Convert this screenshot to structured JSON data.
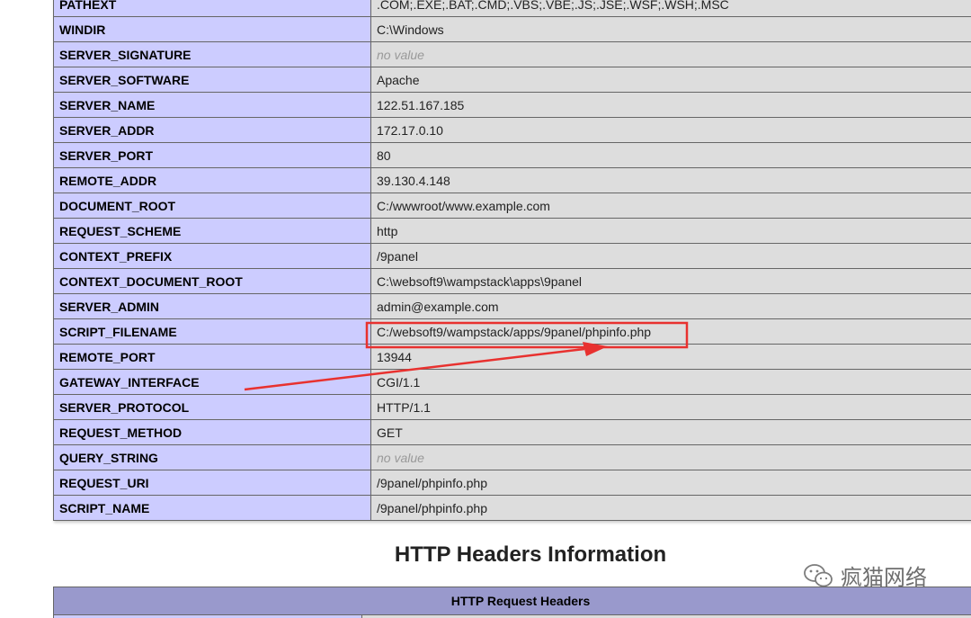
{
  "env_rows": [
    {
      "name": "PATHEXT",
      "value": ".COM;.EXE;.BAT;.CMD;.VBS;.VBE;.JS;.JSE;.WSF;.WSH;.MSC",
      "novalue": false
    },
    {
      "name": "WINDIR",
      "value": "C:\\Windows",
      "novalue": false
    },
    {
      "name": "SERVER_SIGNATURE",
      "value": "no value",
      "novalue": true
    },
    {
      "name": "SERVER_SOFTWARE",
      "value": "Apache",
      "novalue": false
    },
    {
      "name": "SERVER_NAME",
      "value": "122.51.167.185",
      "novalue": false
    },
    {
      "name": "SERVER_ADDR",
      "value": "172.17.0.10",
      "novalue": false
    },
    {
      "name": "SERVER_PORT",
      "value": "80",
      "novalue": false
    },
    {
      "name": "REMOTE_ADDR",
      "value": "39.130.4.148",
      "novalue": false
    },
    {
      "name": "DOCUMENT_ROOT",
      "value": "C:/wwwroot/www.example.com",
      "novalue": false
    },
    {
      "name": "REQUEST_SCHEME",
      "value": "http",
      "novalue": false
    },
    {
      "name": "CONTEXT_PREFIX",
      "value": "/9panel",
      "novalue": false
    },
    {
      "name": "CONTEXT_DOCUMENT_ROOT",
      "value": "C:\\websoft9\\wampstack\\apps\\9panel",
      "novalue": false
    },
    {
      "name": "SERVER_ADMIN",
      "value": "admin@example.com",
      "novalue": false
    },
    {
      "name": "SCRIPT_FILENAME",
      "value": "C:/websoft9/wampstack/apps/9panel/phpinfo.php",
      "novalue": false
    },
    {
      "name": "REMOTE_PORT",
      "value": "13944",
      "novalue": false
    },
    {
      "name": "GATEWAY_INTERFACE",
      "value": "CGI/1.1",
      "novalue": false
    },
    {
      "name": "SERVER_PROTOCOL",
      "value": "HTTP/1.1",
      "novalue": false
    },
    {
      "name": "REQUEST_METHOD",
      "value": "GET",
      "novalue": false
    },
    {
      "name": "QUERY_STRING",
      "value": "no value",
      "novalue": true
    },
    {
      "name": "REQUEST_URI",
      "value": "/9panel/phpinfo.php",
      "novalue": false
    },
    {
      "name": "SCRIPT_NAME",
      "value": "/9panel/phpinfo.php",
      "novalue": false
    }
  ],
  "headers_section": {
    "title": "HTTP Headers Information",
    "table_header": "HTTP Request Headers"
  },
  "watermark": {
    "text": "疯猫网络",
    "icon": "wechat-icon"
  },
  "annotation": {
    "highlight_row": "SCRIPT_FILENAME",
    "color": "#e8312f"
  },
  "colors": {
    "key_cell": "#ccccff",
    "value_cell": "#dddddd",
    "header_cell": "#9999cc",
    "no_value": "#999999"
  }
}
